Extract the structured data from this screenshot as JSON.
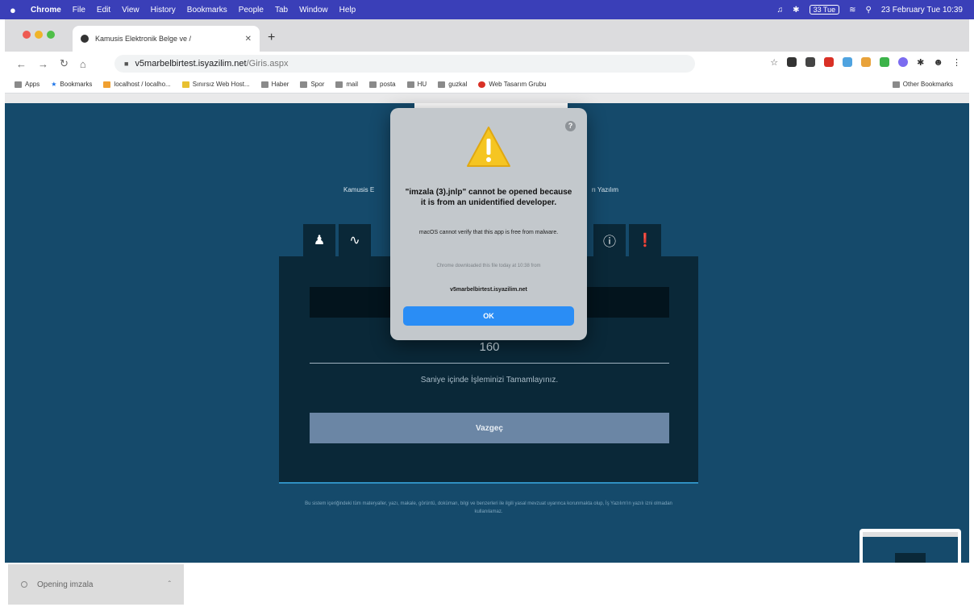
{
  "menubar": {
    "items": [
      "Chrome",
      "File",
      "Edit",
      "View",
      "History",
      "Bookmarks",
      "People",
      "Tab",
      "Window",
      "Help"
    ],
    "battery_text": "33 Tue",
    "datetime": "23 February Tue 10:39"
  },
  "browser": {
    "tab_title": "Kamusis Elektronik Belge ve /",
    "url_domain": "v5marbelbirtest.isyazilim.net",
    "url_path": "/Giris.aspx",
    "bookmarks": [
      "Apps",
      "Bookmarks",
      "localhost / localho...",
      "Sınırsız Web Host...",
      "Haber",
      "Spor",
      "mail",
      "posta",
      "HU",
      "guzkal",
      "Web Tasarım Grubu"
    ],
    "other_bookmarks": "Other Bookmarks"
  },
  "page": {
    "subtitle_left": "Kamusis E",
    "subtitle_right": "rı Yazılım",
    "countdown": "160",
    "countdown_hint": "Saniye içinde İşleminizi Tamamlayınız.",
    "cancel_label": "Vazgeç",
    "footer": "Bu sistem içeriğindeki tüm materyaller, yazı, makale, görüntü, doküman, bilgi ve benzerleri ile ilgili yasal mevzuat uyarınca korunmakta olup, İş Yazılım'ın yazılı izni olmadan kullanılamaz."
  },
  "download": {
    "label": "Opening imzala"
  },
  "dialog": {
    "title": "\"imzala (3).jnlp\" cannot be opened because it is from an unidentified developer.",
    "body": "macOS cannot verify that this app is free from malware.",
    "source_text": "Chrome downloaded this file today at 10:38 from",
    "source_host": "v5marbelbirtest.isyazilim.net",
    "ok_label": "OK",
    "help_glyph": "?"
  },
  "colors": {
    "page_bg": "#154a6b",
    "panel_bg": "#0a2838",
    "button_blue": "#2a8df5",
    "menubar": "#3a3fb8"
  }
}
